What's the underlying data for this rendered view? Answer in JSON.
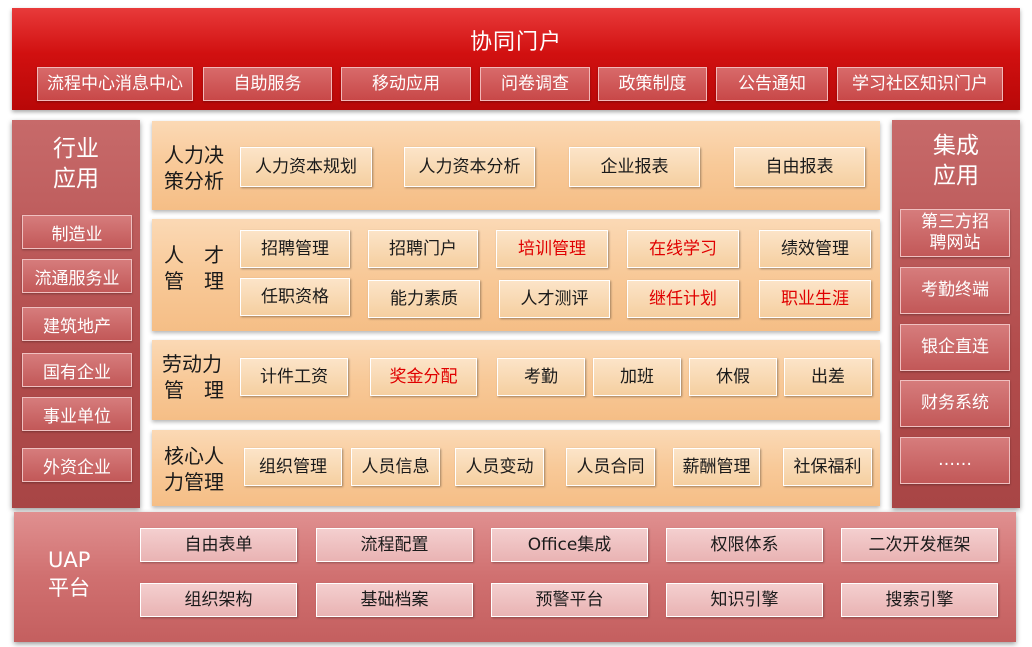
{
  "portal": {
    "title": "协同门户",
    "items": [
      "流程中心消息中心",
      "自助服务",
      "移动应用",
      "问卷调查",
      "政策制度",
      "公告通知",
      "学习社区知识门户"
    ]
  },
  "industry": {
    "title_line1": "行业",
    "title_line2": "应用",
    "items": [
      "制造业",
      "流通服务业",
      "建筑地产",
      "国有企业",
      "事业单位",
      "外资企业"
    ]
  },
  "integration": {
    "title_line1": "集成",
    "title_line2": "应用",
    "items": [
      {
        "line1": "第三方招",
        "line2": "聘网站"
      },
      {
        "line1": "考勤终端",
        "line2": ""
      },
      {
        "line1": "银企直连",
        "line2": ""
      },
      {
        "line1": "财务系统",
        "line2": ""
      },
      {
        "line1": "……",
        "line2": ""
      }
    ]
  },
  "rows": {
    "decision": {
      "label_line1": "人力决",
      "label_line2": "策分析",
      "modules": [
        "人力资本规划",
        "人力资本分析",
        "企业报表",
        "自由报表"
      ]
    },
    "talent": {
      "label_a": "人",
      "label_b": "才",
      "label_c": "管",
      "label_d": "理",
      "modules": [
        "招聘管理",
        "招聘门户",
        "培训管理",
        "在线学习",
        "绩效管理",
        "任职资格",
        "能力素质",
        "人才测评",
        "继任计划",
        "职业生涯"
      ]
    },
    "labor": {
      "label_line1": "劳动力",
      "label_a": "管",
      "label_b": "理",
      "modules": [
        "计件工资",
        "奖金分配",
        "考勤",
        "加班",
        "休假",
        "出差"
      ]
    },
    "core": {
      "label_line1": "核心人",
      "label_line2": "力管理",
      "modules": [
        "组织管理",
        "人员信息",
        "人员变动",
        "人员合同",
        "薪酬管理",
        "社保福利"
      ]
    }
  },
  "uap": {
    "label_line1": "UAP",
    "label_line2": "平台",
    "items": [
      "自由表单",
      "流程配置",
      "Office集成",
      "权限体系",
      "二次开发框架",
      "组织架构",
      "基础档案",
      "预警平台",
      "知识引擎",
      "搜索引擎"
    ]
  },
  "colors": {
    "portal_red": "#d11010",
    "highlight_text": "#e00000",
    "module_fill": "#f5cfa0",
    "side_fill": "#b24c4c"
  }
}
